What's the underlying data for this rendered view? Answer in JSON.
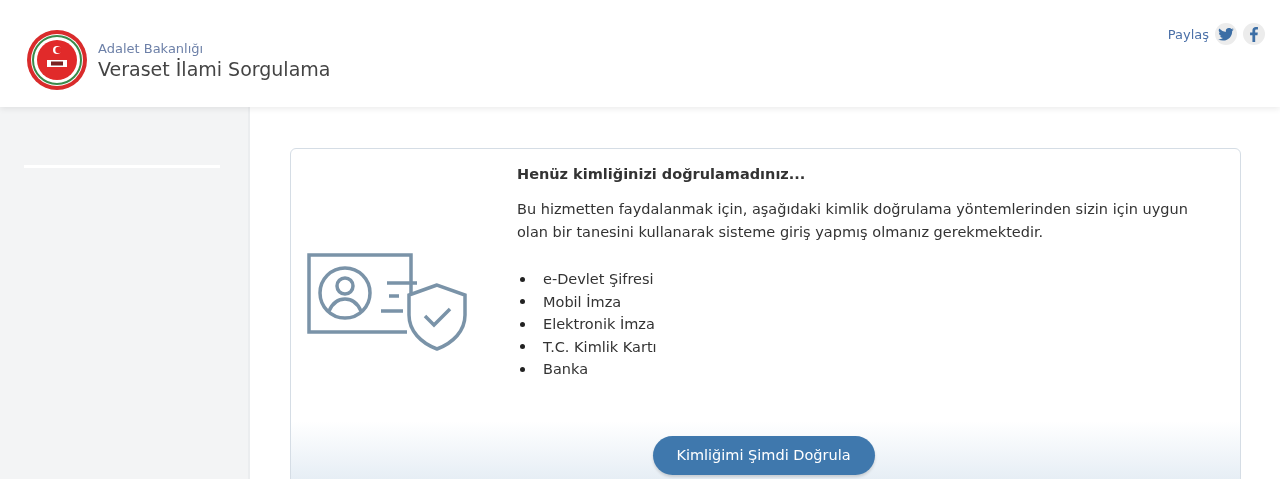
{
  "header": {
    "ministry": "Adalet Bakanlığı",
    "title": "Veraset İlami Sorgulama",
    "share_label": "Paylaş"
  },
  "notice": {
    "heading": "Henüz kimliğinizi doğrulamadınız...",
    "text": "Bu hizmetten faydalanmak için, aşağıdaki kimlik doğrulama yöntemlerinden sizin için uygun olan bir tanesini kullanarak sisteme giriş yapmış olmanız gerekmektedir.",
    "methods": [
      "e-Devlet Şifresi",
      "Mobil İmza",
      "Elektronik İmza",
      "T.C. Kimlik Kartı",
      "Banka"
    ],
    "button": "Kimliğimi Şimdi Doğrula"
  }
}
